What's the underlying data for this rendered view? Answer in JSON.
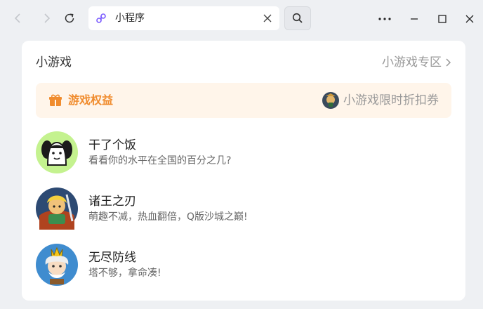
{
  "browser": {
    "url_title": "小程序"
  },
  "card": {
    "title": "小游戏",
    "zone_link": "小游戏专区"
  },
  "banner": {
    "left_label": "游戏权益",
    "right_label": "小游戏限时折扣券"
  },
  "games": [
    {
      "name": "干了个饭",
      "desc": "看看你的水平在全国的百分之几?"
    },
    {
      "name": "诸王之刃",
      "desc": "萌趣不减，热血翻倍，Q版沙城之巅!"
    },
    {
      "name": "无尽防线",
      "desc": "塔不够，拿命凑!"
    }
  ],
  "colors": {
    "accent_orange": "#f08c2e",
    "banner_bg": "#fff5ea",
    "link_purple": "#7b5cff"
  },
  "icons": {
    "back": "chevron-left-icon",
    "forward": "chevron-right-icon",
    "reload": "reload-icon",
    "miniprogram": "miniprogram-link-icon",
    "close": "close-icon",
    "search": "search-icon",
    "more": "more-icon",
    "minimize": "minimize-icon",
    "maximize": "maximize-icon",
    "window_close": "window-close-icon",
    "gift": "gift-icon"
  }
}
